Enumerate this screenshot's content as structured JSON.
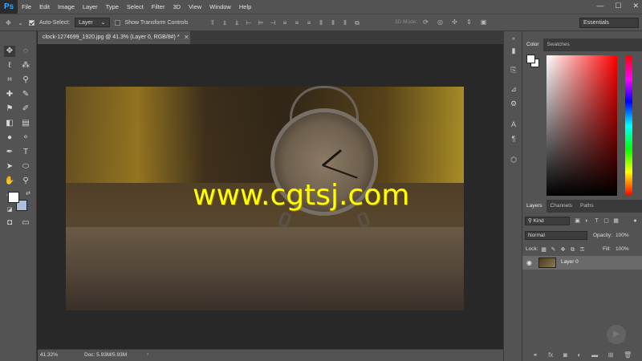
{
  "app": {
    "logo": "Ps"
  },
  "menu": [
    "File",
    "Edit",
    "Image",
    "Layer",
    "Type",
    "Select",
    "Filter",
    "3D",
    "View",
    "Window",
    "Help"
  ],
  "window_controls": {
    "minimize": "—",
    "maximize": "☐",
    "close": "✕"
  },
  "options_bar": {
    "auto_select_label": "Auto-Select:",
    "auto_select_checked": true,
    "auto_select_target": "Layer",
    "show_transform_label": "Show Transform Controls",
    "show_transform_checked": false,
    "mode_3d_label": "3D Mode:",
    "workspace": "Essentials"
  },
  "document": {
    "tab_title": "clock-1274699_1920.jpg @ 41.3% (Layer 0, RGB/8#) *",
    "watermark": "www.cgtsj.com"
  },
  "status": {
    "zoom": "41.32%",
    "doc_size": "Doc: 5.93M/5.93M"
  },
  "panels": {
    "color_tabs": [
      "Color",
      "Swatches"
    ],
    "color_active": "Color",
    "layers_tabs": [
      "Layers",
      "Channels",
      "Paths"
    ],
    "layers_active": "Layers",
    "kind_label": "Kind",
    "blend_mode": "Normal",
    "opacity_label": "Opacity:",
    "opacity_value": "100%",
    "lock_label": "Lock:",
    "fill_label": "Fill:",
    "fill_value": "100%",
    "layers": [
      {
        "name": "Layer 0",
        "visible": true
      }
    ]
  },
  "colors": {
    "foreground": "#ffffff",
    "background": "#ffffff",
    "watermark": "#ffff00",
    "ps_blue": "#31a8ff"
  }
}
